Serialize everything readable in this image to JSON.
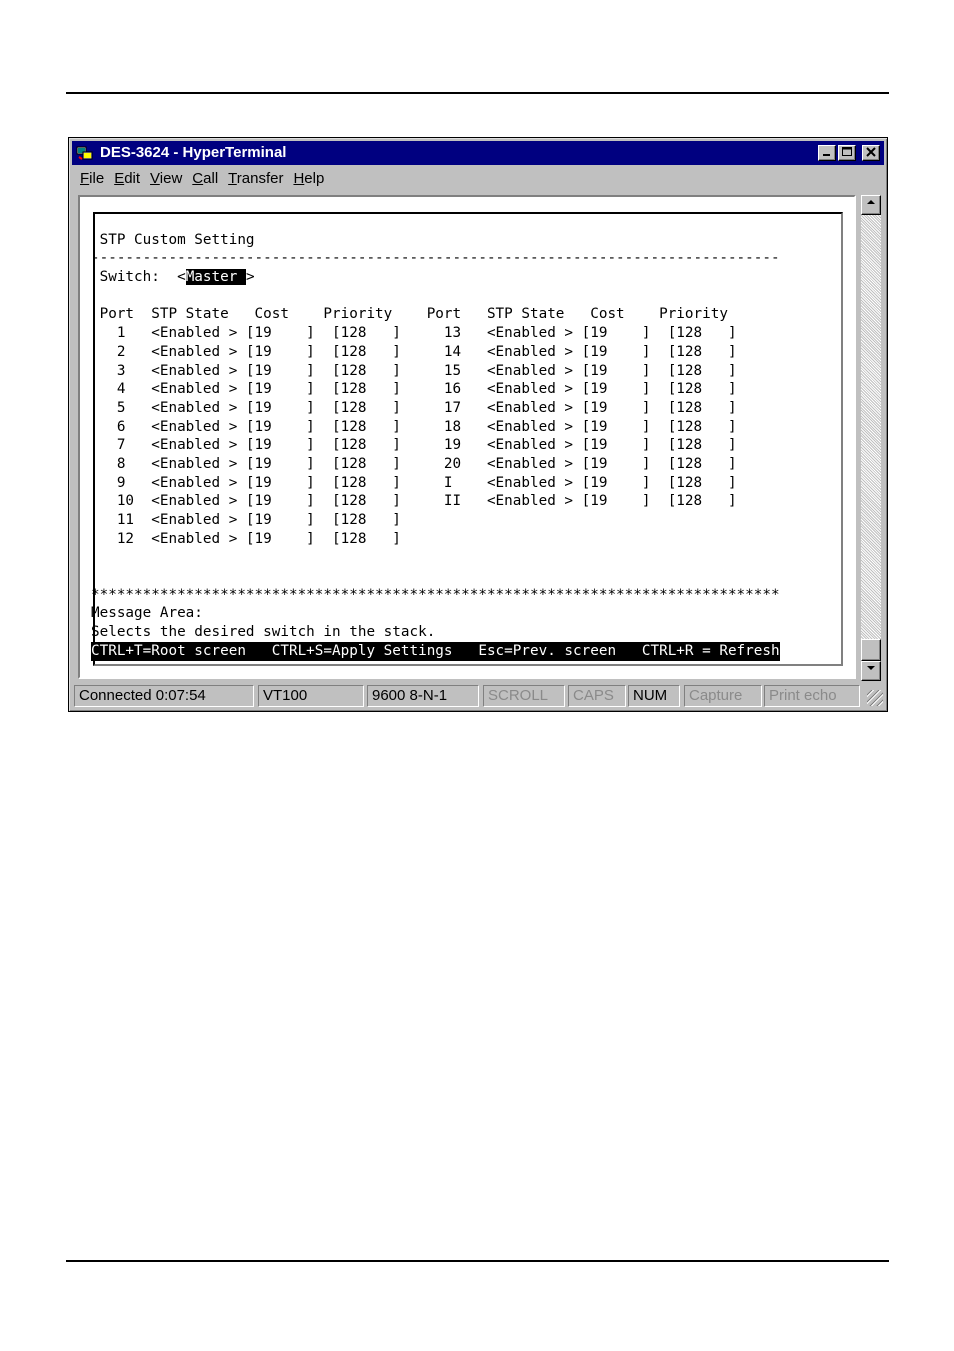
{
  "window": {
    "title": "DES-3624 - HyperTerminal",
    "controls": {
      "minimize": "_",
      "maximize": "□",
      "close": "×"
    }
  },
  "menu": [
    {
      "label": "File",
      "hotkey": "F",
      "rest": "ile"
    },
    {
      "label": "Edit",
      "hotkey": "E",
      "rest": "dit"
    },
    {
      "label": "View",
      "hotkey": "V",
      "rest": "iew"
    },
    {
      "label": "Call",
      "hotkey": "C",
      "rest": "all"
    },
    {
      "label": "Transfer",
      "hotkey": "T",
      "rest": "ransfer"
    },
    {
      "label": "Help",
      "hotkey": "H",
      "rest": "elp"
    }
  ],
  "terminal": {
    "title": "STP Custom Setting",
    "dashes": "--------------------------------------------------------------------------------",
    "switch_label": "Switch:",
    "switch_value": "Master",
    "headers": {
      "port": "Port",
      "state": "STP State",
      "cost": "Cost",
      "priority": "Priority"
    },
    "ports_left": [
      {
        "port": "1",
        "state": "Enabled",
        "cost": "19",
        "priority": "128"
      },
      {
        "port": "2",
        "state": "Enabled",
        "cost": "19",
        "priority": "128"
      },
      {
        "port": "3",
        "state": "Enabled",
        "cost": "19",
        "priority": "128"
      },
      {
        "port": "4",
        "state": "Enabled",
        "cost": "19",
        "priority": "128"
      },
      {
        "port": "5",
        "state": "Enabled",
        "cost": "19",
        "priority": "128"
      },
      {
        "port": "6",
        "state": "Enabled",
        "cost": "19",
        "priority": "128"
      },
      {
        "port": "7",
        "state": "Enabled",
        "cost": "19",
        "priority": "128"
      },
      {
        "port": "8",
        "state": "Enabled",
        "cost": "19",
        "priority": "128"
      },
      {
        "port": "9",
        "state": "Enabled",
        "cost": "19",
        "priority": "128"
      },
      {
        "port": "10",
        "state": "Enabled",
        "cost": "19",
        "priority": "128"
      },
      {
        "port": "11",
        "state": "Enabled",
        "cost": "19",
        "priority": "128"
      },
      {
        "port": "12",
        "state": "Enabled",
        "cost": "19",
        "priority": "128"
      }
    ],
    "ports_right": [
      {
        "port": "13",
        "state": "Enabled",
        "cost": "19",
        "priority": "128"
      },
      {
        "port": "14",
        "state": "Enabled",
        "cost": "19",
        "priority": "128"
      },
      {
        "port": "15",
        "state": "Enabled",
        "cost": "19",
        "priority": "128"
      },
      {
        "port": "16",
        "state": "Enabled",
        "cost": "19",
        "priority": "128"
      },
      {
        "port": "17",
        "state": "Enabled",
        "cost": "19",
        "priority": "128"
      },
      {
        "port": "18",
        "state": "Enabled",
        "cost": "19",
        "priority": "128"
      },
      {
        "port": "19",
        "state": "Enabled",
        "cost": "19",
        "priority": "128"
      },
      {
        "port": "20",
        "state": "Enabled",
        "cost": "19",
        "priority": "128"
      },
      {
        "port": "I",
        "state": "Enabled",
        "cost": "19",
        "priority": "128"
      },
      {
        "port": "II",
        "state": "Enabled",
        "cost": "19",
        "priority": "128"
      }
    ],
    "stars": "********************************************************************************",
    "message_label": "Message Area:",
    "message_text": "Selects the desired switch in the stack.",
    "hotkeys": "CTRL+T=Root screen   CTRL+S=Apply Settings   Esc=Prev. screen   CTRL+R = Refresh"
  },
  "statusbar": {
    "connected": "Connected 0:07:54",
    "emulation": "VT100",
    "settings": "9600 8-N-1",
    "scroll": "SCROLL",
    "caps": "CAPS",
    "num": "NUM",
    "capture": "Capture",
    "print_echo": "Print echo"
  },
  "colors": {
    "titlebar": "#000080",
    "chrome": "#c0c0c0",
    "terminal_bg": "#ffffff",
    "terminal_fg": "#000000"
  }
}
